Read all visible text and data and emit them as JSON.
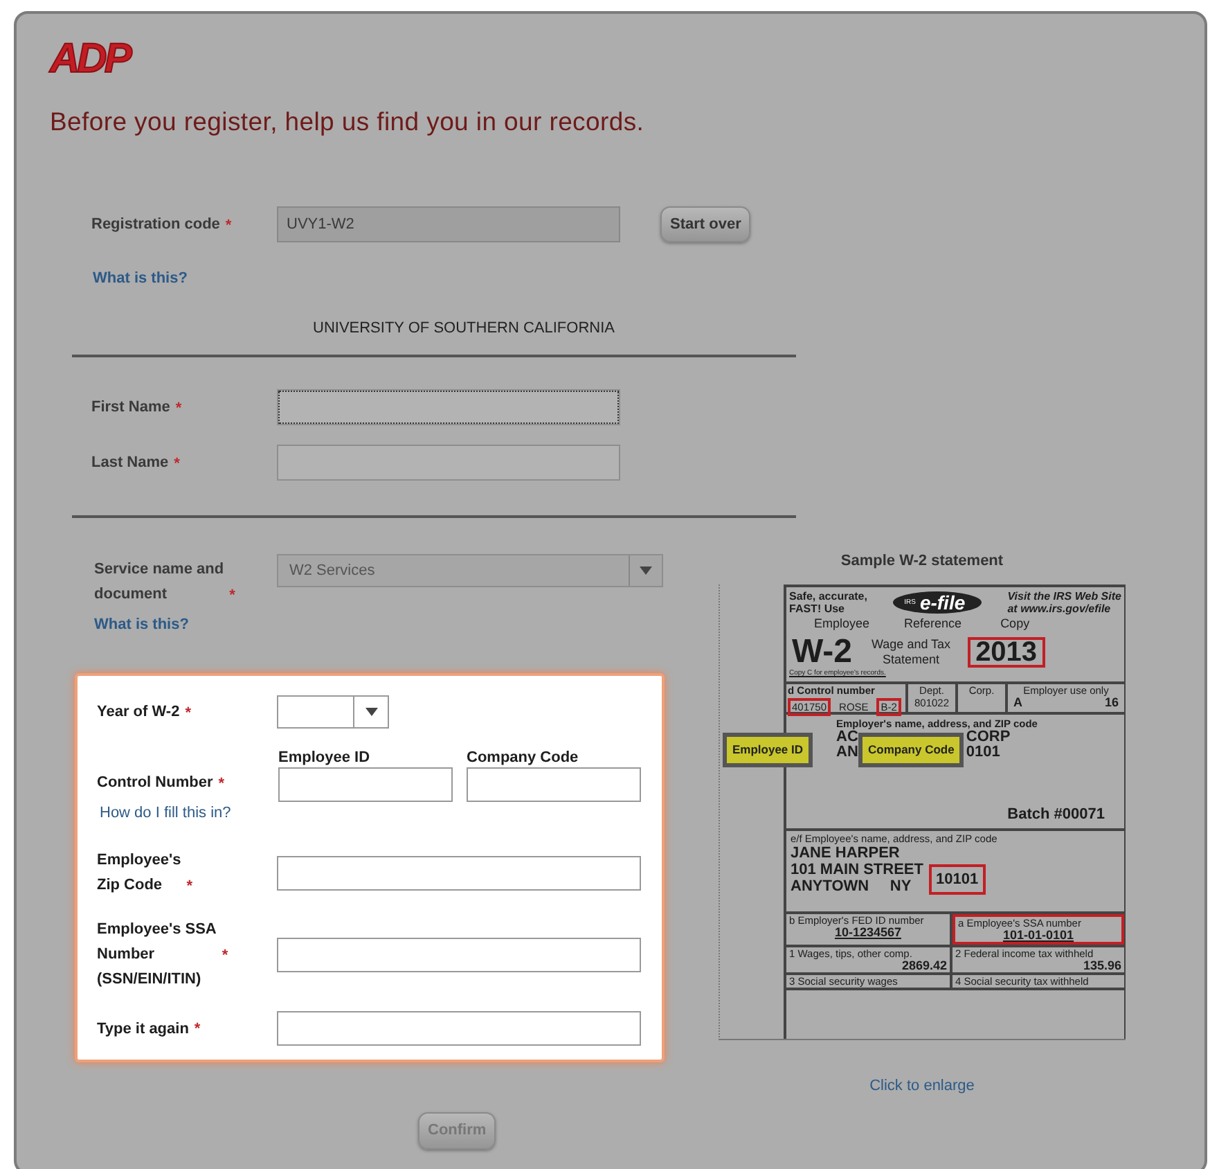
{
  "logo": {
    "text": "ADP"
  },
  "heading": "Before you register, help us find you in our records.",
  "registration": {
    "label": "Registration code",
    "asterisk": "*",
    "value": "UVY1-W2",
    "disabled": true,
    "button": "Start over",
    "help": "What is this?"
  },
  "organization": "UNIVERSITY OF SOUTHERN CALIFORNIA",
  "name_fields": [
    {
      "label": "First Name",
      "asterisk": "*",
      "focused": true
    },
    {
      "label": "Last Name",
      "asterisk": "*",
      "focused": false
    }
  ],
  "service": {
    "label_lines": [
      "Service name and",
      "document"
    ],
    "asterisk": "*",
    "value": "W2 Services",
    "help": "What is this?"
  },
  "lookup_form": {
    "year": {
      "label": "Year of W-2",
      "asterisk": "*"
    },
    "control": {
      "label": "Control Number",
      "asterisk": "*",
      "help": "How do I fill this in?",
      "subfields": [
        {
          "label": "Employee ID"
        },
        {
          "label": "Company Code"
        }
      ]
    },
    "fields": [
      {
        "label_lines": [
          "Employee's",
          "Zip Code"
        ],
        "asterisk": "*"
      },
      {
        "label_lines": [
          "Employee's SSA",
          "Number"
        ],
        "asterisk": "*",
        "note": "(SSN/EIN/ITIN)"
      },
      {
        "label_lines": [
          "Type it again"
        ],
        "asterisk": "*"
      }
    ]
  },
  "confirm": {
    "label": "Confirm",
    "disabled": true
  },
  "sample": {
    "title": "Sample W-2 statement",
    "link": "Click to enlarge",
    "w2": {
      "promo_left": [
        "Safe, accurate,",
        "FAST!  Use"
      ],
      "efile_small": "IRS",
      "efile": "e-file",
      "promo_right": [
        "Visit the IRS Web Site",
        "at www.irs.gov/efile"
      ],
      "form_name": "W-2",
      "ref_row": [
        "Employee",
        "Reference",
        "Copy"
      ],
      "title_lines": [
        "Wage  and  Tax",
        "Statement"
      ],
      "year": {
        "text": "2013",
        "highlighted": true
      },
      "copy_note": "Copy C for employee's records.",
      "control_label": "d   Control number",
      "control_parts": [
        {
          "text": "401750",
          "highlighted": true
        },
        {
          "text": "ROSE",
          "highlighted": false
        },
        {
          "text": "B-2",
          "highlighted": true
        }
      ],
      "dept": {
        "label": "Dept.",
        "value": "801022"
      },
      "corp": {
        "label": "Corp."
      },
      "employer_use": {
        "label": "Employer  use only",
        "values": [
          "A",
          "16"
        ]
      },
      "employer_label": "Employer's name, address, and ZIP code",
      "employer_lines": [
        [
          "AC",
          "CORP"
        ],
        [
          "AN",
          "0101"
        ]
      ],
      "batch": "Batch  #00071",
      "employee_label": "e/f  Employee's name, address, and ZIP code",
      "employee_lines": [
        "JANE HARPER",
        "101 MAIN STREET",
        "ANYTOWN     NY"
      ],
      "zip": {
        "text": "10101",
        "highlighted": true
      },
      "boxes": [
        {
          "label": "b   Employer's FED ID number",
          "value": "10-1234567",
          "highlighted": false
        },
        {
          "label": "a   Employee's SSA number",
          "value": "101-01-0101",
          "highlighted": true
        },
        {
          "label": "1   Wages, tips, other comp.",
          "value": "2869.42",
          "highlighted": false
        },
        {
          "label": "2   Federal income tax withheld",
          "value": "135.96",
          "highlighted": false
        },
        {
          "label": "3   Social security wages",
          "highlighted": false
        },
        {
          "label": "4   Social security tax withheld",
          "highlighted": false
        }
      ]
    },
    "callouts": [
      "Employee ID",
      "Company Code"
    ]
  }
}
